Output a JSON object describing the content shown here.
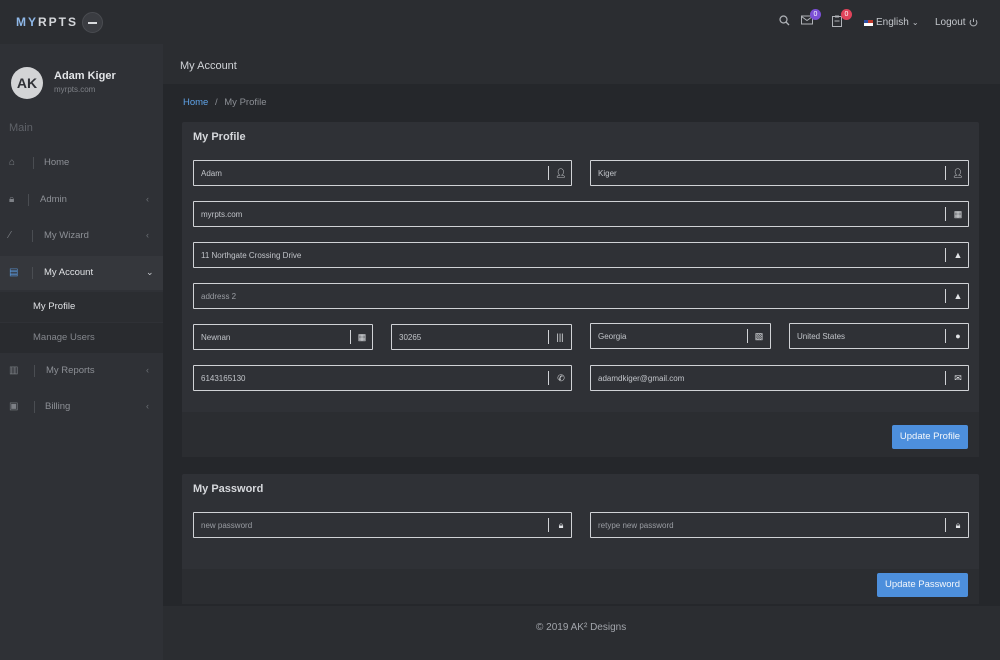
{
  "app": {
    "logo_prefix": "MY",
    "logo_suffix": "RPTS"
  },
  "topbar": {
    "mail_count": "0",
    "tasks_count": "0",
    "mail_badge_color": "#7b4fd6",
    "tasks_badge_color": "#e0435a",
    "language": "English",
    "logout_label": "Logout"
  },
  "sidebar": {
    "user_initials": "AK",
    "user_name": "Adam Kiger",
    "user_site": "myrpts.com",
    "section_label": "Main",
    "items": [
      {
        "label": "Home",
        "icon": "home-icon"
      },
      {
        "label": "Admin",
        "icon": "lock-icon"
      },
      {
        "label": "My Wizard",
        "icon": "wand-icon"
      },
      {
        "label": "My Account",
        "icon": "account-icon"
      },
      {
        "label": "My Reports",
        "icon": "chart-icon"
      },
      {
        "label": "Billing",
        "icon": "money-icon"
      }
    ],
    "sub_items": [
      {
        "label": "My Profile"
      },
      {
        "label": "Manage Users"
      }
    ]
  },
  "page": {
    "title": "My Account",
    "breadcrumb_home": "Home",
    "breadcrumb_sep": "/",
    "breadcrumb_current": "My Profile"
  },
  "profile": {
    "title": "My Profile",
    "first_name": "Adam",
    "last_name": "Kiger",
    "company": "myrpts.com",
    "address1": "11 Northgate Crossing Drive",
    "address2_placeholder": "address 2",
    "city": "Newnan",
    "zip": "30265",
    "state": "Georgia",
    "country": "United States",
    "phone": "6143165130",
    "email": "adamdkiger@gmail.com",
    "update_label": "Update Profile"
  },
  "password": {
    "title": "My Password",
    "new_placeholder": "new password",
    "retype_placeholder": "retype new password",
    "update_label": "Update Password"
  },
  "footer": {
    "text": "© 2019 AK² Designs"
  },
  "colors": {
    "accent": "#4d8fdc",
    "link": "#5fa3e8"
  }
}
